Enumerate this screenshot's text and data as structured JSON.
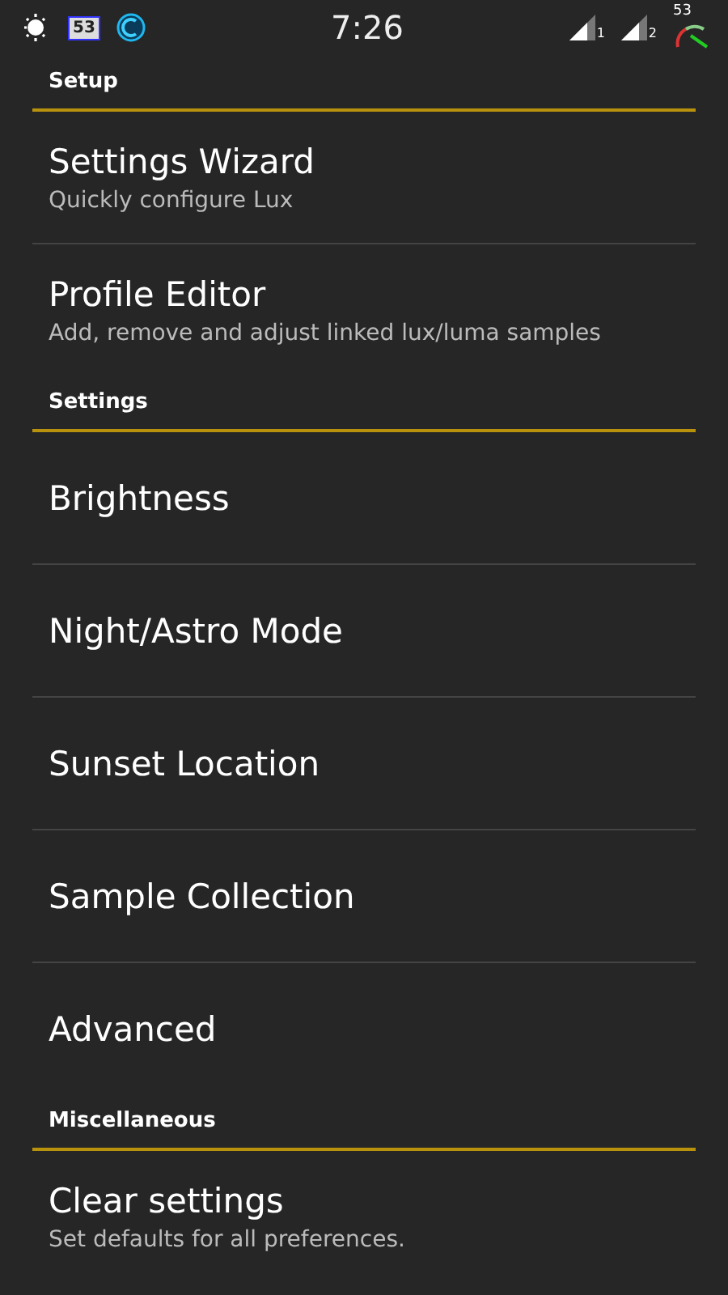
{
  "status_bar": {
    "notification_badge": "53",
    "time": "7:26",
    "sim_1": "1",
    "sim_2": "2",
    "gauge_reading": "53"
  },
  "sections": [
    {
      "title": "Setup",
      "items": [
        {
          "title": "Settings Wizard",
          "summary": "Quickly configure Lux"
        },
        {
          "title": "Profile Editor",
          "summary": "Add, remove and adjust linked lux/luma samples"
        }
      ]
    },
    {
      "title": "Settings",
      "items": [
        {
          "title": "Brightness"
        },
        {
          "title": "Night/Astro Mode"
        },
        {
          "title": "Sunset Location"
        },
        {
          "title": "Sample Collection"
        },
        {
          "title": "Advanced"
        }
      ]
    },
    {
      "title": "Miscellaneous",
      "items": [
        {
          "title": "Clear settings",
          "summary": "Set defaults for all preferences."
        }
      ]
    }
  ]
}
